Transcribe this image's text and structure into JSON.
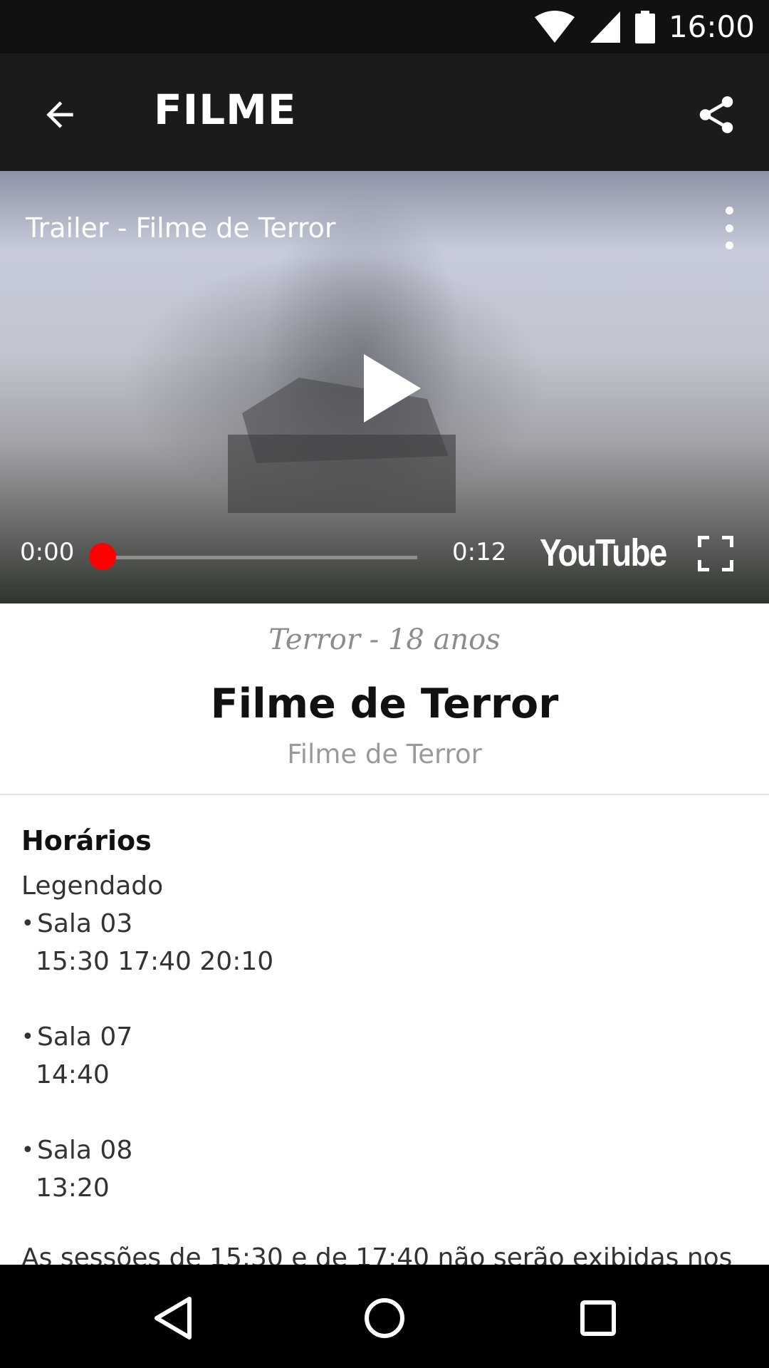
{
  "status_bar": {
    "time": "16:00"
  },
  "app_bar": {
    "title": "FILME"
  },
  "video": {
    "title": "Trailer - Filme de Terror",
    "current_time": "0:00",
    "duration": "0:12",
    "progress": 0,
    "brand": "YouTube",
    "accent_color": "#ff0000"
  },
  "movie": {
    "genre_rating": "Terror - 18 anos",
    "title": "Filme de Terror",
    "subtitle": "Filme de Terror"
  },
  "schedule": {
    "heading": "Horários",
    "type": "Legendado",
    "rooms": [
      {
        "name": "Sala 03",
        "times": "15:30 17:40 20:10"
      },
      {
        "name": "Sala 07",
        "times": "14:40"
      },
      {
        "name": "Sala 08",
        "times": "13:20"
      }
    ],
    "note": "As sessões de 15:30 e de 17:40 não serão exibidas nos"
  }
}
